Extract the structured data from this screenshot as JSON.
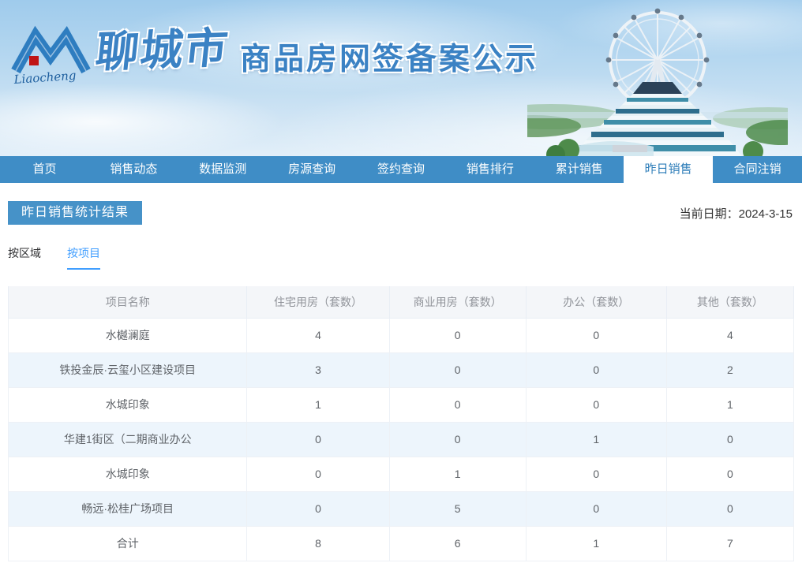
{
  "header": {
    "logo_text": "Liaocheng",
    "city": "聊城市",
    "title": "商品房网签备案公示"
  },
  "nav": {
    "items": [
      {
        "label": "首页",
        "active": false
      },
      {
        "label": "销售动态",
        "active": false
      },
      {
        "label": "数据监测",
        "active": false
      },
      {
        "label": "房源查询",
        "active": false
      },
      {
        "label": "签约查询",
        "active": false
      },
      {
        "label": "销售排行",
        "active": false
      },
      {
        "label": "累计销售",
        "active": false
      },
      {
        "label": "昨日销售",
        "active": true
      },
      {
        "label": "合同注销",
        "active": false
      }
    ]
  },
  "page": {
    "section_title": "昨日销售统计结果",
    "date_label": "当前日期：",
    "date_value": "2024-3-15"
  },
  "tabs": [
    {
      "label": "按区域",
      "active": false
    },
    {
      "label": "按项目",
      "active": true
    }
  ],
  "table": {
    "columns": [
      "项目名称",
      "住宅用房（套数）",
      "商业用房（套数）",
      "办公（套数）",
      "其他（套数）"
    ],
    "rows": [
      {
        "name": "水樾澜庭",
        "values": [
          "4",
          "0",
          "0",
          "4"
        ]
      },
      {
        "name": "铁投金辰·云玺小区建设项目",
        "values": [
          "3",
          "0",
          "0",
          "2"
        ]
      },
      {
        "name": "水城印象",
        "values": [
          "1",
          "0",
          "0",
          "1"
        ]
      },
      {
        "name": "华建1街区（二期商业办公",
        "values": [
          "0",
          "0",
          "1",
          "0"
        ]
      },
      {
        "name": "水城印象",
        "values": [
          "0",
          "1",
          "0",
          "0"
        ]
      },
      {
        "name": "畅远·松桂广场项目",
        "values": [
          "0",
          "5",
          "0",
          "0"
        ]
      },
      {
        "name": "合计",
        "values": [
          "8",
          "6",
          "1",
          "7"
        ]
      }
    ]
  },
  "colors": {
    "nav_blue": "#3f8dc6",
    "nav_active_text": "#2c7cb8",
    "badge_blue": "#4692c8",
    "tab_active_blue": "#409eff",
    "banner_title_blue": "#3b82c4",
    "table_header_bg": "#f4f6f9",
    "table_stripe_bg": "#edf5fc",
    "table_header_text": "#909399",
    "table_cell_text": "#5f6368"
  }
}
